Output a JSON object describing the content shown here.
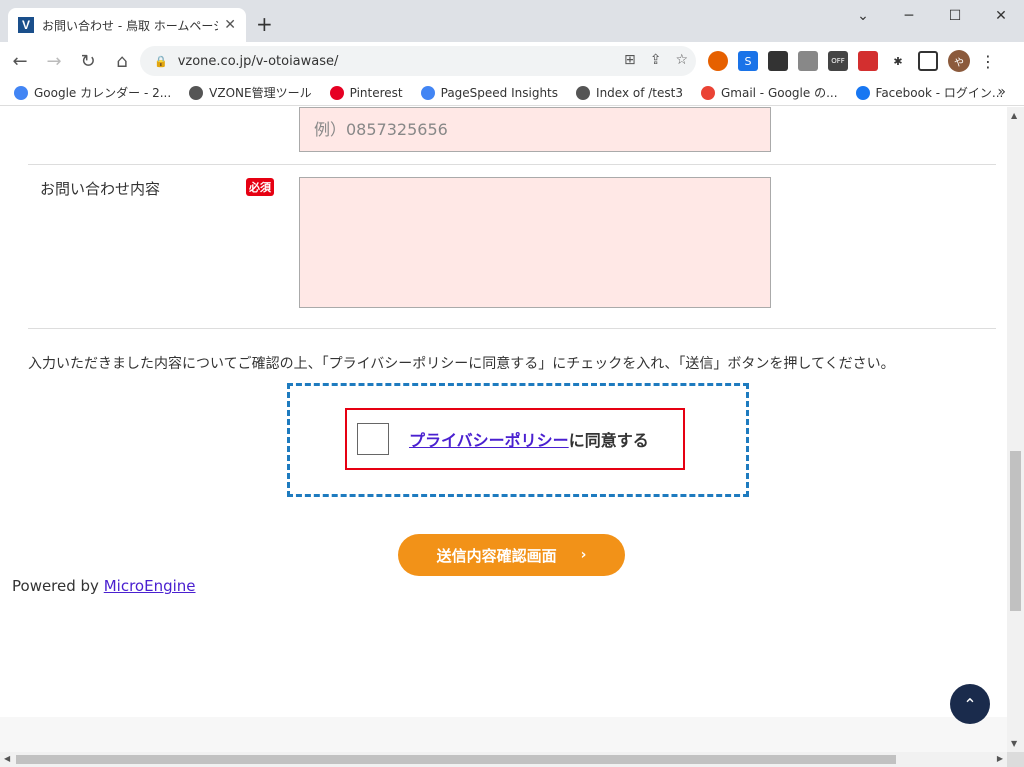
{
  "tab": {
    "favicon_letter": "V",
    "title": "お問い合わせ - 鳥取 ホームページ作成",
    "close": "✕"
  },
  "new_tab": "+",
  "window": {
    "minimize": "─",
    "maximize": "☐",
    "close": "✕",
    "chevron": "⌄"
  },
  "address": {
    "url": "vzone.co.jp/v-otoiawase/"
  },
  "bookmarks": [
    {
      "label": "Google カレンダー - 2...",
      "color": "#4285f4"
    },
    {
      "label": "VZONE管理ツール",
      "color": "#555555"
    },
    {
      "label": "Pinterest",
      "color": "#e60023"
    },
    {
      "label": "PageSpeed Insights",
      "color": "#4285f4"
    },
    {
      "label": "Index of /test3",
      "color": "#555555"
    },
    {
      "label": "Gmail - Google の...",
      "color": "#ea4335"
    },
    {
      "label": "Facebook - ログイン...",
      "color": "#1877f2"
    }
  ],
  "bookmarks_more": "»",
  "form": {
    "phone_placeholder": "例）0857325656",
    "inquiry_label": "お問い合わせ内容",
    "required_badge": "必須",
    "instructions": "入力いただきました内容についてご確認の上、「プライバシーポリシーに同意する」にチェックを入れ、「送信」ボタンを押してください。",
    "privacy_link": "プライバシーポリシー",
    "agree_text": "に同意する",
    "submit_label": "送信内容確認画面",
    "submit_chevron": "›"
  },
  "footer": {
    "powered_by": "Powered by",
    "powered_link": "MicroEngine"
  },
  "colors": {
    "accent_orange": "#f29218",
    "required_red": "#e60012",
    "dashed_blue": "#1e7bbf",
    "input_pink": "#ffe8e6"
  }
}
